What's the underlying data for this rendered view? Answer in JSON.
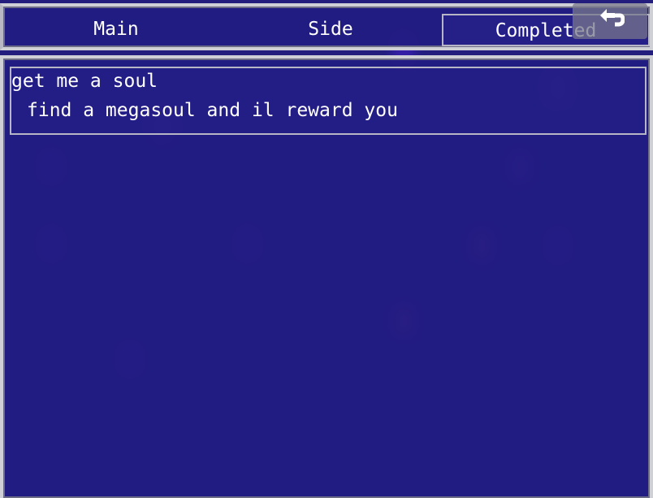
{
  "tabs": [
    {
      "label": "Main",
      "selected": false
    },
    {
      "label": "Side",
      "selected": false
    },
    {
      "label": "Completed",
      "selected": true
    }
  ],
  "back_button": {
    "icon": "return-arrow-icon"
  },
  "quests": [
    {
      "title": "get me a soul",
      "description": "find a megasoul and il reward you"
    }
  ],
  "colors": {
    "window_bg": "#221c82",
    "border": "#cfcfd6",
    "text": "#ffffff"
  }
}
